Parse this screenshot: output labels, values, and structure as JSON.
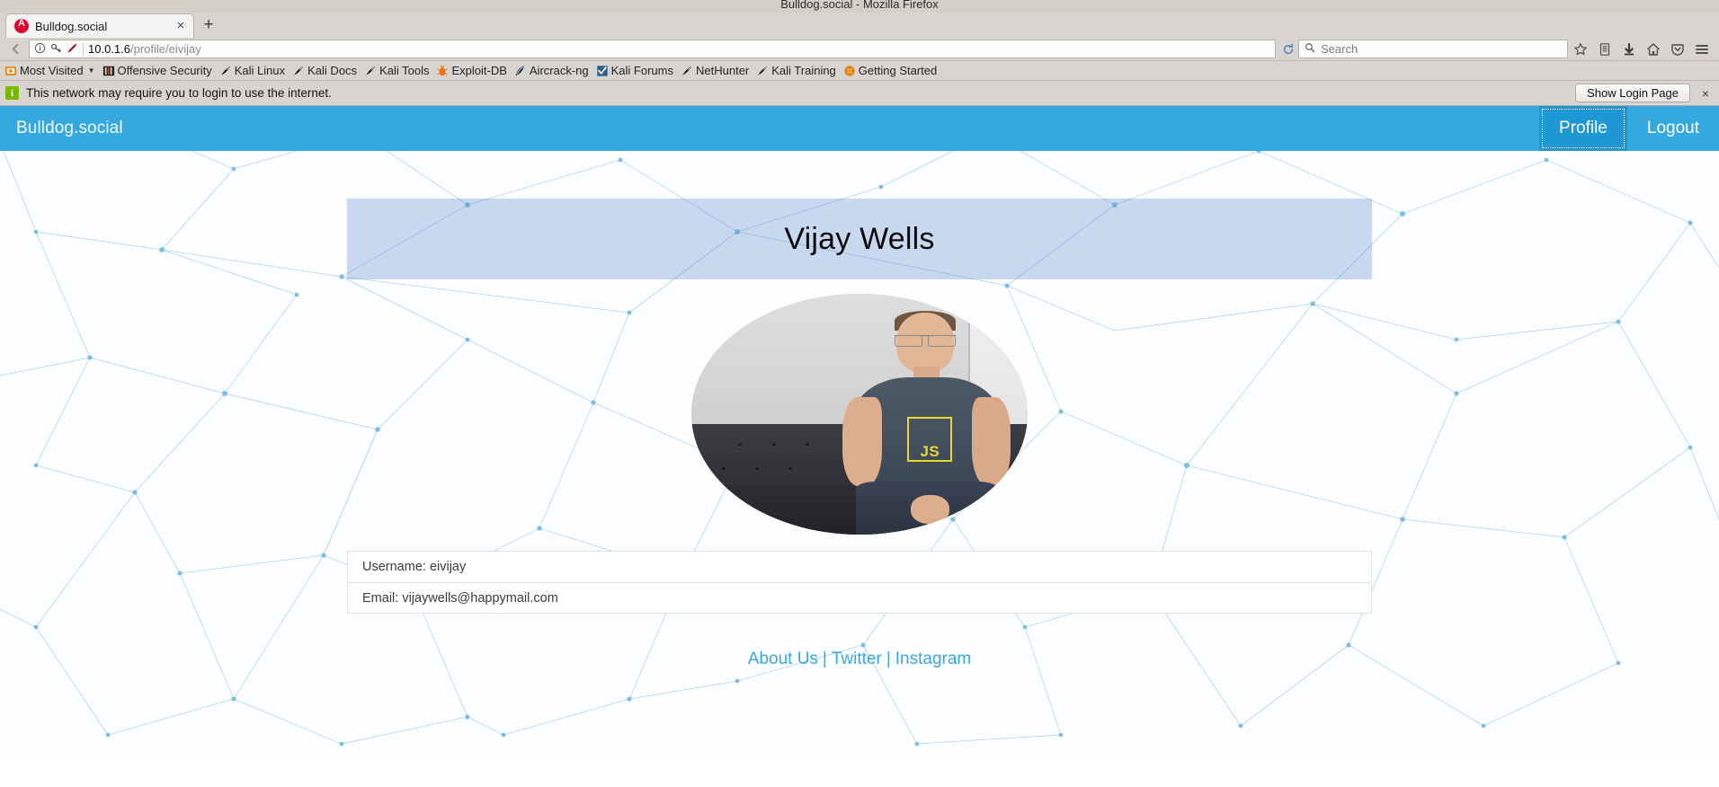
{
  "window": {
    "title": "Bulldog.social - Mozilla Firefox"
  },
  "tab": {
    "title": "Bulldog.social",
    "favicon": "angular-icon",
    "close": "×",
    "newtab": "+"
  },
  "navigation": {
    "back_icon": "back-arrow-icon",
    "url_host": "10.0.1.6",
    "url_path": "/profile/eivijay",
    "identity_icon": "info-icon",
    "key_icon": "key-icon",
    "no_script_icon": "noscript-icon",
    "reload_icon": "reload-icon"
  },
  "search": {
    "placeholder": "Search",
    "icon": "search-icon"
  },
  "toolbar_icons": [
    {
      "name": "bookmark-star-icon",
      "glyph": "☆"
    },
    {
      "name": "library-icon",
      "glyph": "▤"
    },
    {
      "name": "downloads-icon",
      "glyph": "↓"
    },
    {
      "name": "home-icon",
      "glyph": "⌂"
    },
    {
      "name": "pocket-icon",
      "glyph": "⬟"
    },
    {
      "name": "menu-hamburger-icon",
      "glyph": "☰"
    }
  ],
  "bookmarks": [
    {
      "label": "Most Visited",
      "icon": "most-visited-icon",
      "has_chevron": true
    },
    {
      "label": "Offensive Security",
      "icon": "offensive-security-icon",
      "has_chevron": false
    },
    {
      "label": "Kali Linux",
      "icon": "kali-dragon-icon",
      "has_chevron": false
    },
    {
      "label": "Kali Docs",
      "icon": "kali-dragon-icon",
      "has_chevron": false
    },
    {
      "label": "Kali Tools",
      "icon": "kali-dragon-icon",
      "has_chevron": false
    },
    {
      "label": "Exploit-DB",
      "icon": "exploit-db-icon",
      "has_chevron": false
    },
    {
      "label": "Aircrack-ng",
      "icon": "aircrack-ng-icon",
      "has_chevron": false
    },
    {
      "label": "Kali Forums",
      "icon": "kali-forums-icon",
      "has_chevron": false
    },
    {
      "label": "NetHunter",
      "icon": "kali-dragon-icon",
      "has_chevron": false
    },
    {
      "label": "Kali Training",
      "icon": "kali-dragon-icon",
      "has_chevron": false
    },
    {
      "label": "Getting Started",
      "icon": "getting-started-icon",
      "has_chevron": false
    }
  ],
  "notification": {
    "icon": "info-badge-icon",
    "message": "This network may require you to login to use the internet.",
    "button_label": "Show Login Page",
    "close_label": "×"
  },
  "app": {
    "brand": "Bulldog.social",
    "nav": [
      {
        "label": "Profile",
        "active": true
      },
      {
        "label": "Logout",
        "active": false
      }
    ],
    "accent_color": "#35a8e0",
    "accent_active_color": "#1f97d4"
  },
  "profile": {
    "display_name": "Vijay Wells",
    "banner_color": "rgba(92,140,205,0.33)",
    "avatar_alt": "smiling-man-in-js-tshirt-on-couch",
    "avatar_shirt_logo": "JS",
    "info": [
      {
        "label": "Username: eivijay"
      },
      {
        "label": "Email: vijaywells@happymail.com"
      }
    ]
  },
  "footer": {
    "links": [
      {
        "label": "About Us"
      },
      {
        "label": "Twitter"
      },
      {
        "label": "Instagram"
      }
    ],
    "separator": "|"
  }
}
